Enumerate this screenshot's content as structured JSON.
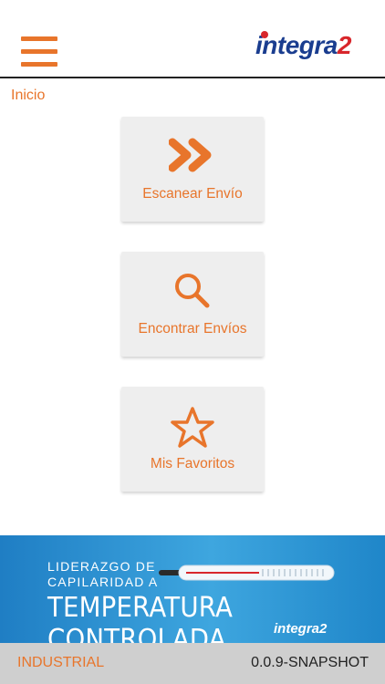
{
  "header": {
    "logo_text_base": "integra",
    "logo_text_accent": "2"
  },
  "breadcrumb": "Inicio",
  "menu": {
    "cards": [
      {
        "label": "Escanear Envío",
        "icon": "double-chevron-right-icon"
      },
      {
        "label": "Encontrar Envíos",
        "icon": "search-icon"
      },
      {
        "label": "Mis Favoritos",
        "icon": "star-icon"
      }
    ]
  },
  "banner": {
    "line1": "LIDERAZGO DE",
    "line2": "CAPILARIDAD A",
    "line3": "TEMPERATURA CONTROLADA",
    "brand": "integra2"
  },
  "footer": {
    "mode": "INDUSTRIAL",
    "version": "0.0.9-SNAPSHOT"
  },
  "colors": {
    "accent": "#e8752b",
    "card_bg": "#eeeeee",
    "logo_blue": "#1a3d8f",
    "logo_red": "#d8262b",
    "footer_bg": "#cfcfcf"
  }
}
